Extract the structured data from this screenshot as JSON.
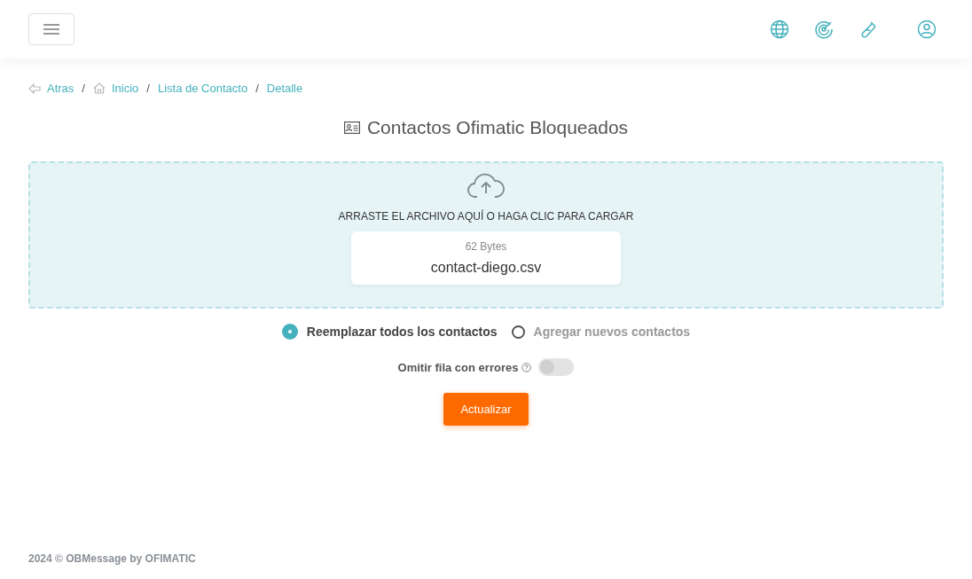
{
  "breadcrumb": {
    "separator": "/",
    "items": [
      {
        "label": "Atras",
        "kind": "back"
      },
      {
        "label": "Inicio",
        "kind": "home"
      },
      {
        "label": "Lista de Contacto",
        "kind": "link"
      },
      {
        "label": "Detalle",
        "kind": "link"
      }
    ]
  },
  "title": "Contactos Ofimatic Bloqueados",
  "dropzone": {
    "prompt": "ARRASTE EL ARCHIVO AQUÍ O HAGA CLIC PARA CARGAR",
    "file": {
      "size": "62 Bytes",
      "name": "contact-diego.csv"
    }
  },
  "modes": [
    {
      "label": "Reemplazar todos los contactos",
      "selected": true
    },
    {
      "label": "Agregar nuevos contactos",
      "selected": false
    }
  ],
  "skip_errors": {
    "label": "Omitir fila con errores",
    "on": false
  },
  "submit": "Actualizar",
  "footer": "2024 © OBMessage by OFIMATIC"
}
